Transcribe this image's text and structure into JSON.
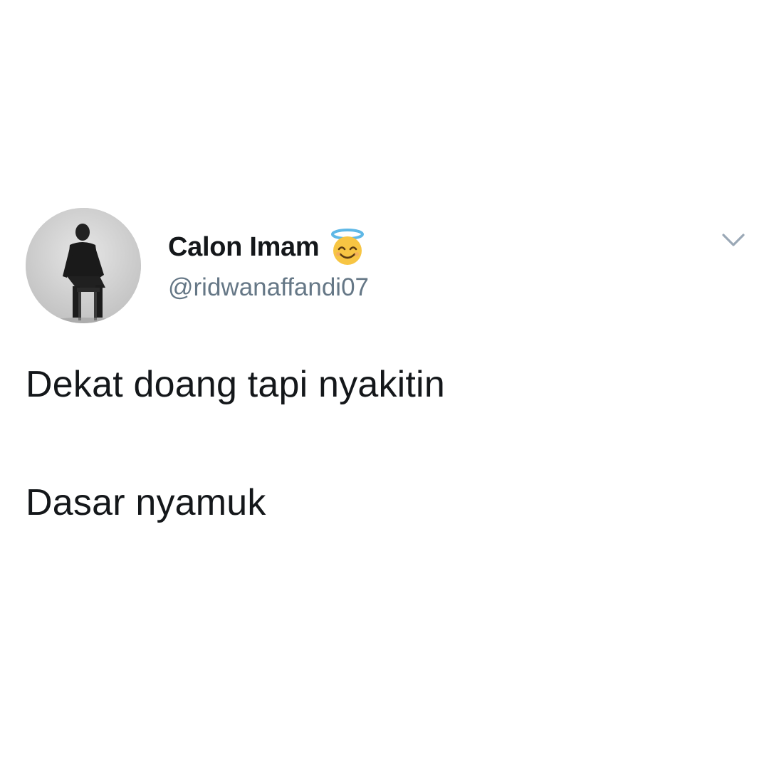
{
  "author": {
    "display_name": "Calon Imam",
    "name_emoji": "smiling-face-with-halo-icon",
    "handle": "@ridwanaffandi07",
    "avatar": "profile-photo"
  },
  "tweet": {
    "lines": [
      "Dekat doang tapi nyakitin",
      "Dasar nyamuk"
    ]
  },
  "controls": {
    "menu_icon": "chevron-down-icon"
  },
  "colors": {
    "text_primary": "#14171a",
    "text_secondary": "#657786",
    "chevron": "#9aa8b6",
    "background": "#ffffff"
  }
}
